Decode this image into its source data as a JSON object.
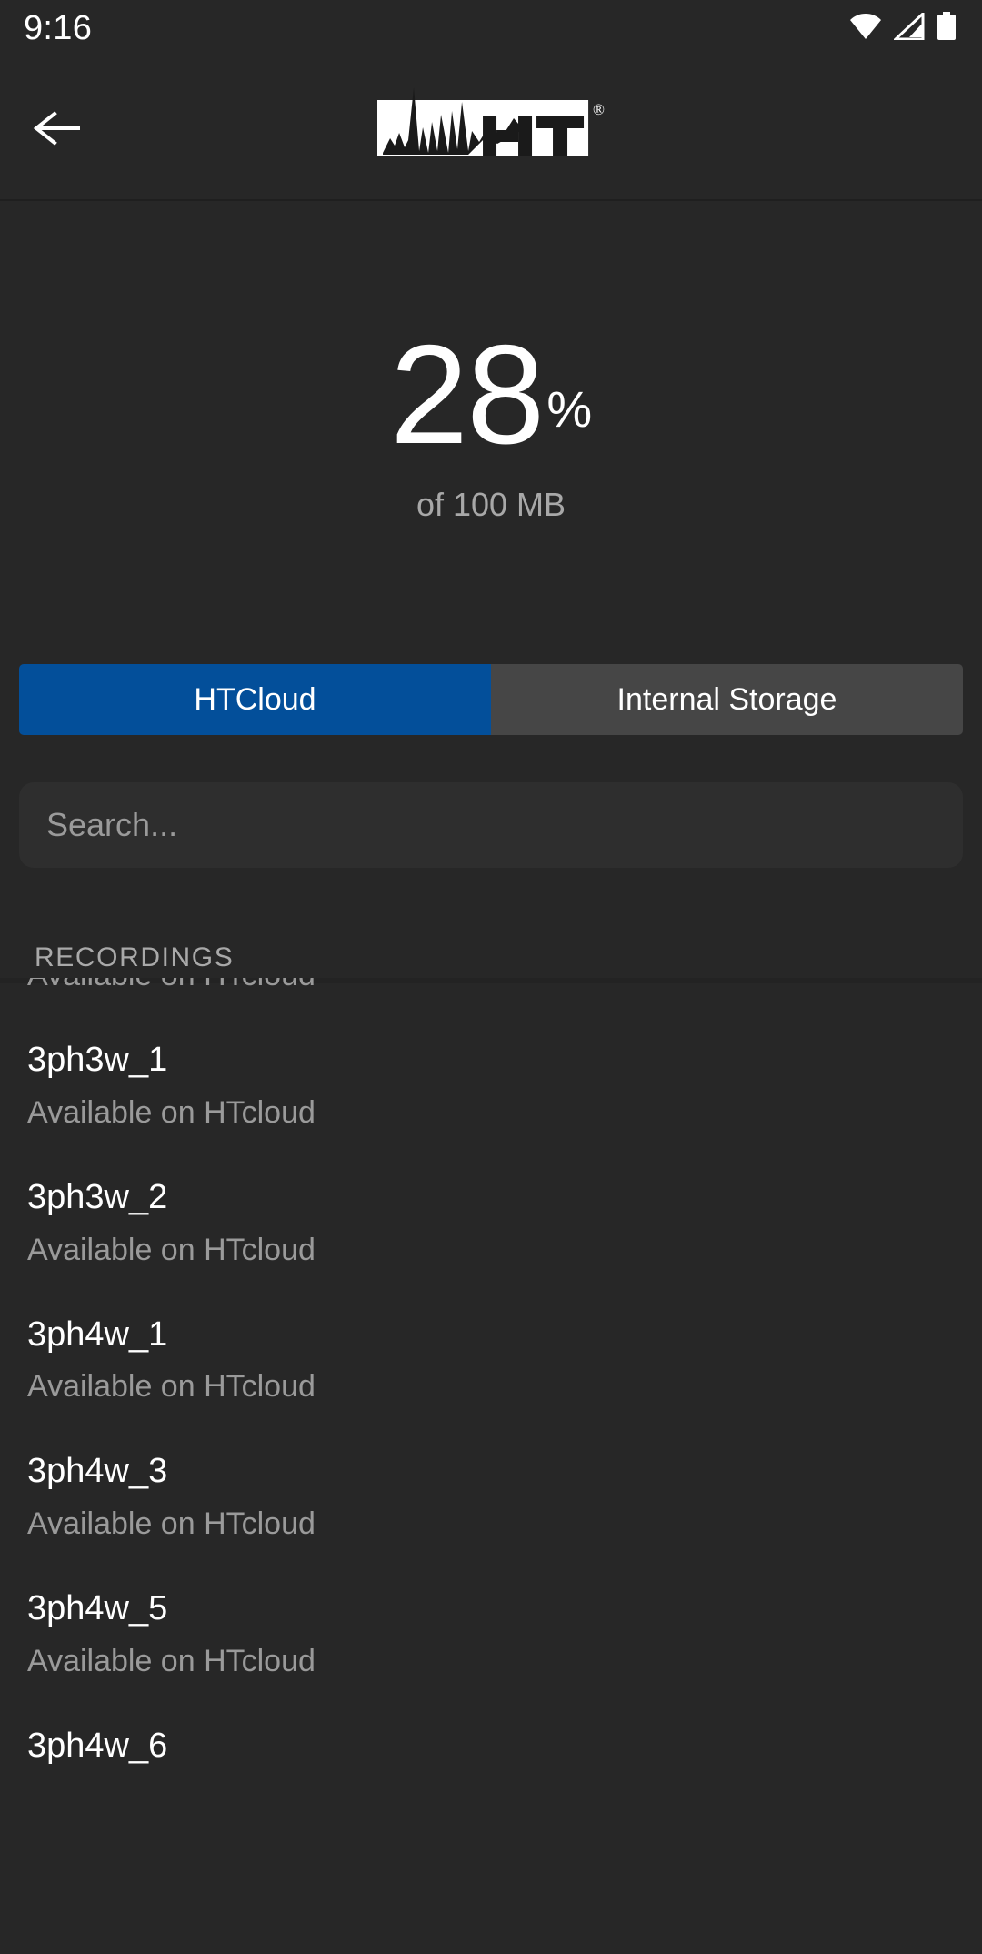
{
  "statusbar": {
    "time": "9:16",
    "icons": [
      {
        "name": "wifi-icon",
        "label": "wifi-full"
      },
      {
        "name": "cellular-signal-icon",
        "label": "signal-partial"
      },
      {
        "name": "battery-icon",
        "label": "battery-full"
      }
    ]
  },
  "appbar": {
    "back_label": "Back",
    "logo_text": "HT",
    "registered_mark": "®"
  },
  "quota": {
    "value": "28",
    "unit": "%",
    "subtitle": "of 100 MB",
    "used_percent": 28,
    "total_label": "100 MB"
  },
  "tabs": [
    {
      "label": "HTCloud",
      "active": true
    },
    {
      "label": "Internal Storage",
      "active": false
    }
  ],
  "search": {
    "placeholder": "Search...",
    "value": ""
  },
  "section": {
    "title": "RECORDINGS"
  },
  "recordings": [
    {
      "title": "",
      "subtitle": "Available on HTcloud",
      "partial_top": true
    },
    {
      "title": "3ph3w_1",
      "subtitle": "Available on HTcloud"
    },
    {
      "title": "3ph3w_2",
      "subtitle": "Available on HTcloud"
    },
    {
      "title": "3ph4w_1",
      "subtitle": "Available on HTcloud"
    },
    {
      "title": "3ph4w_3",
      "subtitle": "Available on HTcloud"
    },
    {
      "title": "3ph4w_5",
      "subtitle": "Available on HTcloud"
    },
    {
      "title": "3ph4w_6",
      "subtitle": ""
    }
  ],
  "colors": {
    "background": "#272727",
    "accent_blue": "#034f9a",
    "tab_inactive": "#464646",
    "search_field": "#2e2e2e",
    "primary_text": "#ffffff",
    "secondary_text": "#9a9a9a"
  }
}
